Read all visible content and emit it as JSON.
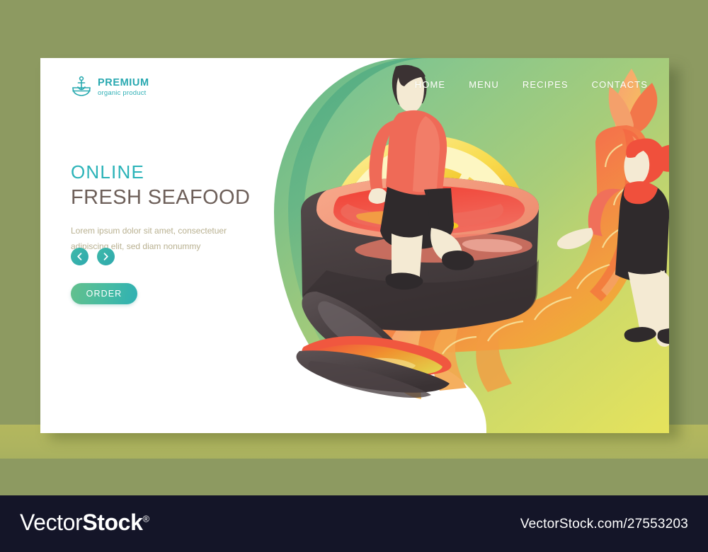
{
  "page": {
    "background_color": "#8d9a61",
    "card_background": "#ffffff"
  },
  "header": {
    "logo": {
      "icon": "anchor-bowl-icon",
      "title": "PREMIUM",
      "subtitle": "organic product",
      "color": "#29aab0"
    },
    "nav": [
      {
        "label": "HOME"
      },
      {
        "label": "MENU"
      },
      {
        "label": "RECIPES"
      },
      {
        "label": "CONTACTS"
      }
    ]
  },
  "hero": {
    "eyebrow": "ONLINE",
    "title": "FRESH SEAFOOD",
    "description_line1": "Lorem ipsum dolor sit amet, consectetuer",
    "description_line2": "adipiscing elit, sed diam nonummy",
    "prev_label": "‹",
    "next_label": "›",
    "cta_label": "ORDER",
    "eyebrow_color": "#2bb3b8",
    "title_color": "#6d5f59",
    "accent_color": "#2fb0b3"
  },
  "illustration": {
    "description": "Giant bowl of red seafood soup with a man sitting on the rim, a huge lemon slice, an open mussel and a large shrimp held by a woman",
    "items": [
      {
        "name": "lemon-slice",
        "color": "#f2c225"
      },
      {
        "name": "soup-pot",
        "color": "#4a4347"
      },
      {
        "name": "soup-broth",
        "color": "#ef3b33"
      },
      {
        "name": "mussel",
        "color": "#4a4347"
      },
      {
        "name": "shrimp",
        "color": "#f07a3c"
      },
      {
        "name": "man-character",
        "shirt_color": "#ef6a57"
      },
      {
        "name": "woman-character",
        "hair_color": "#ef5240"
      }
    ]
  },
  "watermark": {
    "brand_thin": "Vector",
    "brand_bold": "Stock",
    "registered": "®",
    "url": "VectorStock.com/27553203",
    "bar_color": "#141528"
  }
}
